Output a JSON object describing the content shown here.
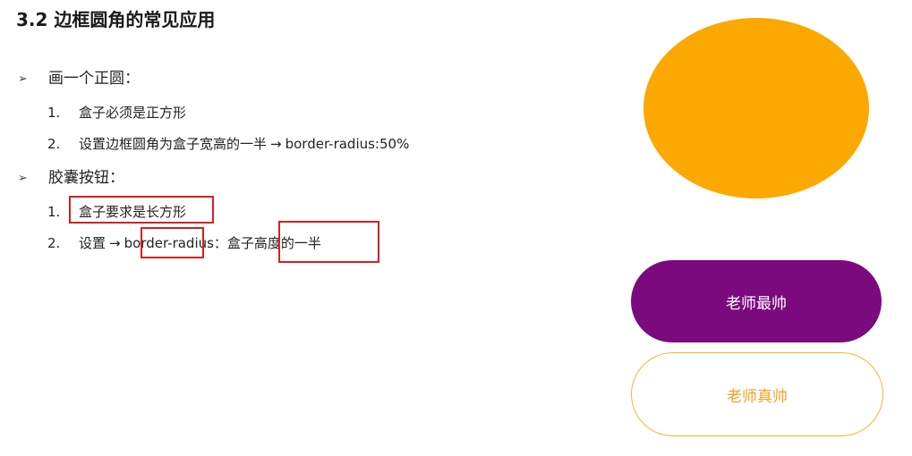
{
  "title": "3.2 边框圆角的常见应用",
  "sections": [
    {
      "bullet": "➢",
      "heading": "画一个正圆：",
      "items": [
        {
          "num": "1.",
          "text": "盒子必须是正方形"
        },
        {
          "num": "2.",
          "text_before": "设置边框圆角为盒子宽高的一半",
          "arrow": "→",
          "text_after": "border-radius:50%"
        }
      ]
    },
    {
      "bullet": "➢",
      "heading": "胶囊按钮：",
      "items": [
        {
          "num": "1.",
          "text": "盒子要求是长方形"
        },
        {
          "num": "2.",
          "text_before": "设置",
          "arrow": "→",
          "text_after": "border-radius：盒子高度的一半"
        }
      ]
    }
  ],
  "demo": {
    "circle_color": "#fba800",
    "capsule_purple": {
      "label": "老师最帅",
      "bg": "#7c0a7f",
      "color": "#ffffff"
    },
    "capsule_outline": {
      "label": "老师真帅",
      "border": "#f1b829",
      "color": "#f0a321"
    }
  },
  "annotation_color": "#d42020"
}
